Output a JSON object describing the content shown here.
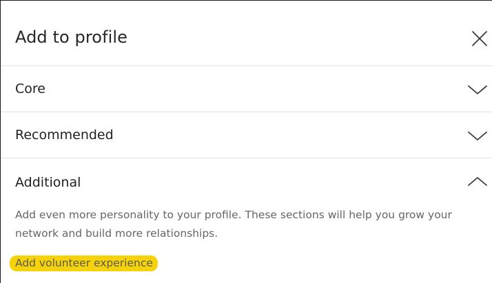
{
  "dialog": {
    "title": "Add to profile",
    "close_icon": "close-icon"
  },
  "sections": {
    "core": {
      "label": "Core",
      "state": "collapsed",
      "icon": "chevron-down-icon"
    },
    "recommended": {
      "label": "Recommended",
      "state": "collapsed",
      "icon": "chevron-down-icon"
    },
    "additional": {
      "label": "Additional",
      "state": "expanded",
      "icon": "chevron-up-icon",
      "description": "Add even more personality to your profile. These sections will help you grow your network and build more relationships.",
      "links": [
        {
          "label": "Add volunteer experience"
        }
      ]
    }
  },
  "colors": {
    "highlight": "#f5d20a",
    "divider": "#e2e2e2",
    "muted_text": "#666666"
  }
}
